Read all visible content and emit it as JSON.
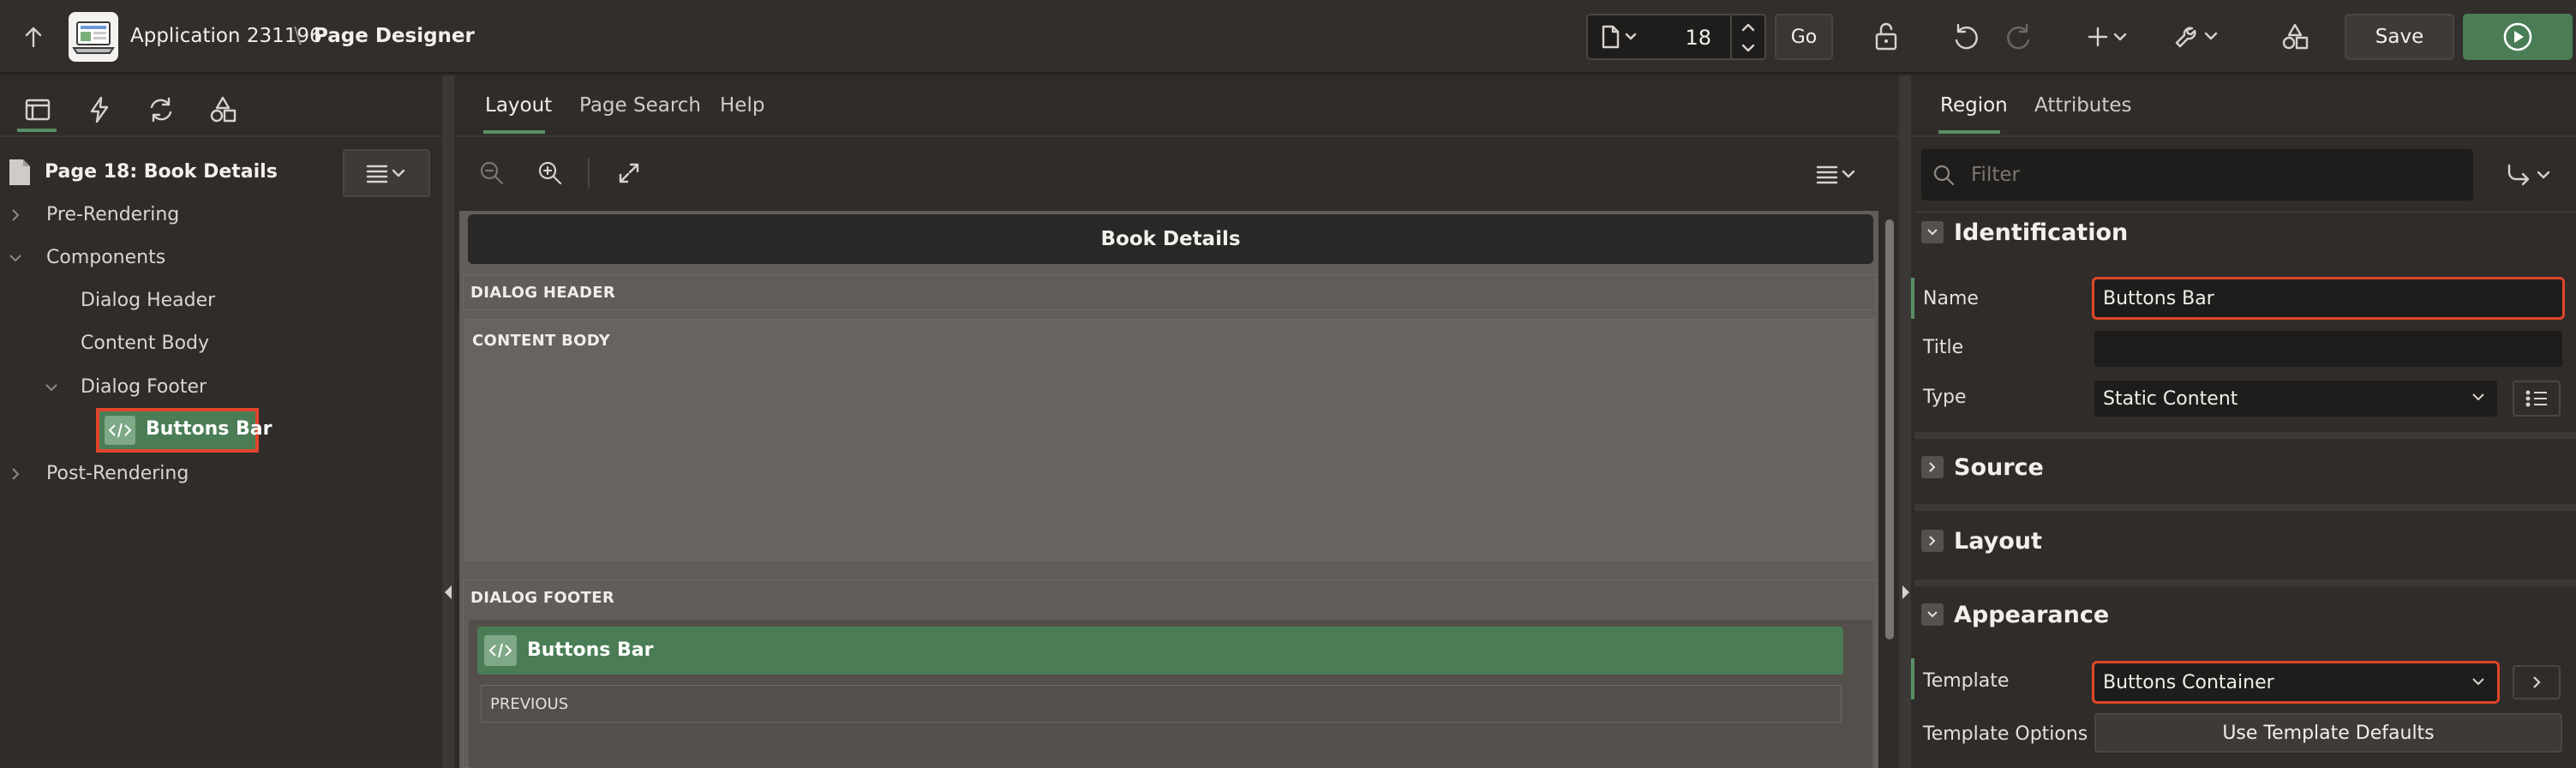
{
  "header": {
    "app_name": "Application 231196",
    "separator": "\\",
    "page_designer": "Page Designer",
    "page_number": "18",
    "go_label": "Go",
    "save_label": "Save"
  },
  "left_panel": {
    "page_title": "Page 18: Book Details",
    "tree": {
      "pre_rendering": "Pre-Rendering",
      "components": "Components",
      "dialog_header": "Dialog Header",
      "content_body": "Content Body",
      "dialog_footer": "Dialog Footer",
      "buttons_bar": "Buttons Bar",
      "post_rendering": "Post-Rendering"
    }
  },
  "center_panel": {
    "tabs": [
      "Layout",
      "Page Search",
      "Help"
    ],
    "active_tab": "Layout",
    "dialog_title": "Book Details",
    "dialog_header": "DIALOG HEADER",
    "content_body": "CONTENT BODY",
    "dialog_footer": "DIALOG FOOTER",
    "buttons_bar": "Buttons Bar",
    "previous": "PREVIOUS"
  },
  "right_panel": {
    "tabs": [
      "Region",
      "Attributes"
    ],
    "active_tab": "Region",
    "filter_placeholder": "Filter",
    "groups": {
      "identification": "Identification",
      "source": "Source",
      "layout": "Layout",
      "appearance": "Appearance"
    },
    "fields": {
      "name_label": "Name",
      "name_value": "Buttons Bar",
      "title_label": "Title",
      "title_value": "",
      "type_label": "Type",
      "type_value": "Static Content",
      "template_label": "Template",
      "template_value": "Buttons Container",
      "template_options_label": "Template Options",
      "template_options_button": "Use Template Defaults"
    }
  },
  "colors": {
    "accent_green": "#4a7d55",
    "highlight_red": "#e0452c",
    "background": "#2b2927"
  }
}
